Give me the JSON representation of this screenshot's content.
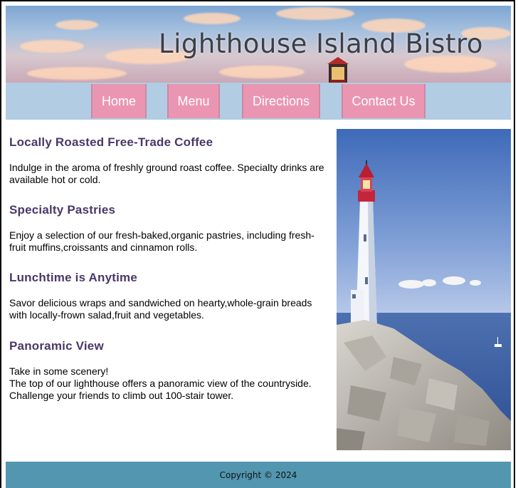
{
  "header": {
    "title": "Lighthouse Island Bistro"
  },
  "nav": {
    "items": [
      {
        "label": "Home"
      },
      {
        "label": "Menu"
      },
      {
        "label": "Directions"
      },
      {
        "label": "Contact Us"
      }
    ]
  },
  "sections": [
    {
      "heading": "Locally Roasted Free-Trade Coffee",
      "lines": [
        "Indulge in the aroma of freshly ground roast coffee. Specialty drinks are available hot or cold."
      ]
    },
    {
      "heading": "Specialty Pastries",
      "lines": [
        "Enjoy a selection of our fresh-baked,organic pastries, including fresh-fruit muffins,croissants and cinnamon rolls."
      ]
    },
    {
      "heading": "Lunchtime is Anytime",
      "lines": [
        "Savor delicious wraps and sandwiched on hearty,whole-grain breads with locally-frown salad,fruit and vegetables."
      ]
    },
    {
      "heading": "Panoramic View",
      "lines": [
        "Take in some scenery!",
        "The top of our lighthouse offers a panoramic view of the countryside. Challenge your friends to climb out 100-stair tower."
      ]
    }
  ],
  "footer": {
    "copyright": "Copyright © 2024"
  },
  "colors": {
    "nav_bar": "#b1cce3",
    "nav_button": "#ea96b2",
    "heading": "#4a3868",
    "footer": "#5296b0"
  }
}
